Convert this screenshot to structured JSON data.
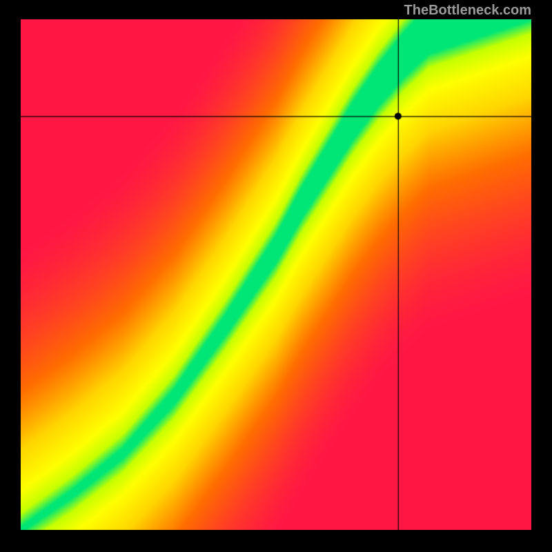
{
  "watermark": "TheBottleneck.com",
  "chart_data": {
    "type": "heatmap",
    "title": "",
    "xlabel": "",
    "ylabel": "",
    "xlim": [
      0,
      1
    ],
    "ylim": [
      0,
      1
    ],
    "crosshair": {
      "x": 0.74,
      "y": 0.81
    },
    "description": "Bottleneck heatmap. Green diagonal band indicates balanced pairing; red/orange regions indicate bottleneck. Crosshair marks selected CPU/GPU point.",
    "colormap_stops": [
      {
        "t": 0.0,
        "color": "#ff1744"
      },
      {
        "t": 0.35,
        "color": "#ff6d00"
      },
      {
        "t": 0.6,
        "color": "#ffd600"
      },
      {
        "t": 0.8,
        "color": "#ffff00"
      },
      {
        "t": 0.92,
        "color": "#c6ff00"
      },
      {
        "t": 1.0,
        "color": "#00e676"
      }
    ],
    "ideal_curve_points": [
      {
        "x": 0.0,
        "y": 0.0
      },
      {
        "x": 0.1,
        "y": 0.07
      },
      {
        "x": 0.2,
        "y": 0.15
      },
      {
        "x": 0.3,
        "y": 0.26
      },
      {
        "x": 0.4,
        "y": 0.4
      },
      {
        "x": 0.5,
        "y": 0.55
      },
      {
        "x": 0.55,
        "y": 0.64
      },
      {
        "x": 0.6,
        "y": 0.72
      },
      {
        "x": 0.65,
        "y": 0.8
      },
      {
        "x": 0.7,
        "y": 0.87
      },
      {
        "x": 0.75,
        "y": 0.93
      },
      {
        "x": 0.8,
        "y": 0.98
      },
      {
        "x": 0.85,
        "y": 1.0
      }
    ],
    "band_width_points": [
      {
        "x": 0.0,
        "w": 0.01
      },
      {
        "x": 0.2,
        "w": 0.02
      },
      {
        "x": 0.4,
        "w": 0.04
      },
      {
        "x": 0.55,
        "w": 0.06
      },
      {
        "x": 0.7,
        "w": 0.08
      },
      {
        "x": 0.85,
        "w": 0.1
      },
      {
        "x": 1.0,
        "w": 0.12
      }
    ]
  }
}
